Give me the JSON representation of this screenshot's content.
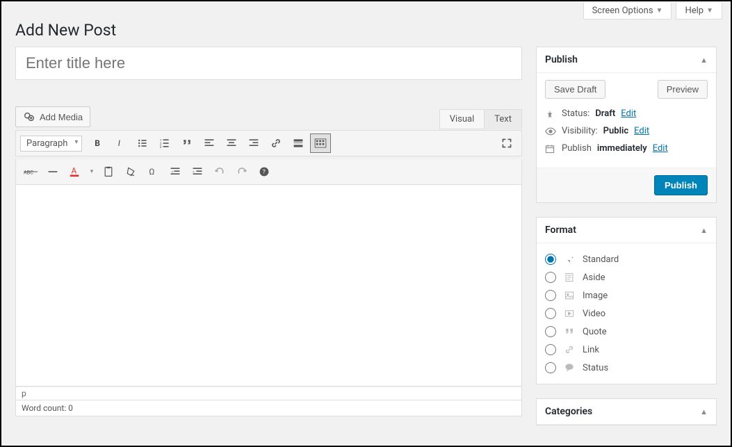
{
  "top": {
    "screen_options": "Screen Options",
    "help": "Help"
  },
  "page_title": "Add New Post",
  "title_placeholder": "Enter title here",
  "add_media": "Add Media",
  "editor_tabs": {
    "visual": "Visual",
    "text": "Text"
  },
  "toolbar": {
    "paragraph": "Paragraph"
  },
  "editor_status": "p",
  "word_count": "Word count: 0",
  "publish": {
    "title": "Publish",
    "save_draft": "Save Draft",
    "preview": "Preview",
    "status_label": "Status:",
    "status_value": "Draft",
    "status_edit": "Edit",
    "visibility_label": "Visibility:",
    "visibility_value": "Public",
    "visibility_edit": "Edit",
    "schedule_label": "Publish",
    "schedule_value": "immediately",
    "schedule_edit": "Edit",
    "publish_btn": "Publish"
  },
  "format": {
    "title": "Format",
    "options": [
      "Standard",
      "Aside",
      "Image",
      "Video",
      "Quote",
      "Link",
      "Status"
    ]
  },
  "categories": {
    "title": "Categories"
  }
}
